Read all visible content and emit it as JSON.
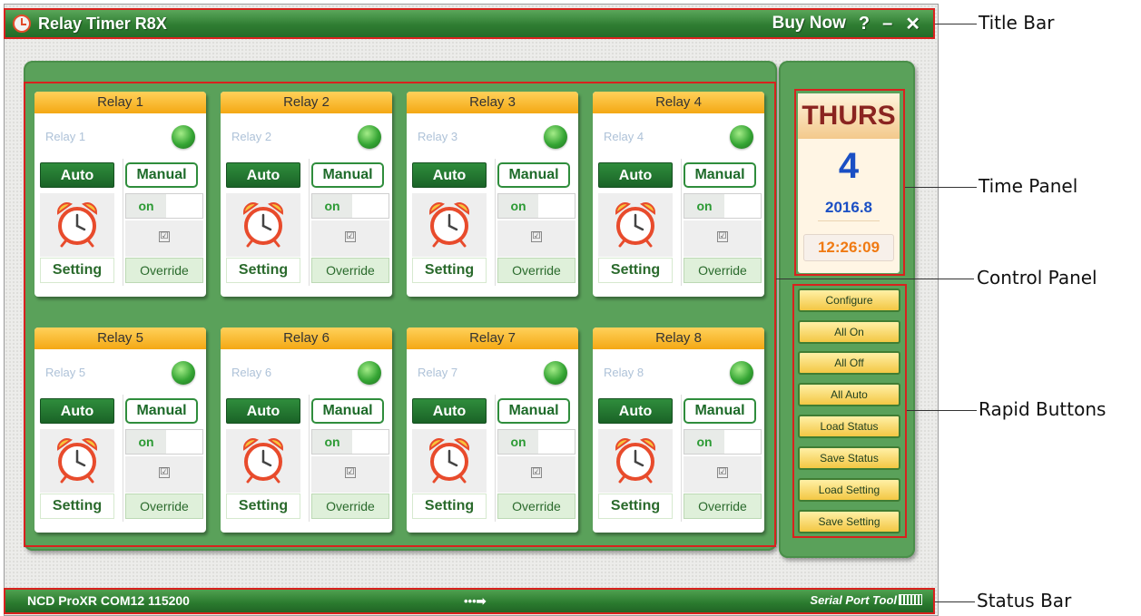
{
  "window": {
    "title": "Relay Timer R8X",
    "buy_now": "Buy Now",
    "help": "?",
    "minimize": "–",
    "close": "✕"
  },
  "relays": [
    {
      "header": "Relay 1",
      "name": "Relay 1",
      "auto": "Auto",
      "manual": "Manual",
      "toggle": "on",
      "setting": "Setting",
      "override": "Override",
      "check": "☑"
    },
    {
      "header": "Relay 2",
      "name": "Relay 2",
      "auto": "Auto",
      "manual": "Manual",
      "toggle": "on",
      "setting": "Setting",
      "override": "Override",
      "check": "☑"
    },
    {
      "header": "Relay 3",
      "name": "Relay 3",
      "auto": "Auto",
      "manual": "Manual",
      "toggle": "on",
      "setting": "Setting",
      "override": "Override",
      "check": "☑"
    },
    {
      "header": "Relay 4",
      "name": "Relay 4",
      "auto": "Auto",
      "manual": "Manual",
      "toggle": "on",
      "setting": "Setting",
      "override": "Override",
      "check": "☑"
    },
    {
      "header": "Relay 5",
      "name": "Relay 5",
      "auto": "Auto",
      "manual": "Manual",
      "toggle": "on",
      "setting": "Setting",
      "override": "Override",
      "check": "☑"
    },
    {
      "header": "Relay 6",
      "name": "Relay 6",
      "auto": "Auto",
      "manual": "Manual",
      "toggle": "on",
      "setting": "Setting",
      "override": "Override",
      "check": "☑"
    },
    {
      "header": "Relay 7",
      "name": "Relay 7",
      "auto": "Auto",
      "manual": "Manual",
      "toggle": "on",
      "setting": "Setting",
      "override": "Override",
      "check": "☑"
    },
    {
      "header": "Relay 8",
      "name": "Relay 8",
      "auto": "Auto",
      "manual": "Manual",
      "toggle": "on",
      "setting": "Setting",
      "override": "Override",
      "check": "☑"
    }
  ],
  "time": {
    "day": "THURS",
    "date": "4",
    "year_month": "2016.8",
    "clock": "12:26:09"
  },
  "rapid_buttons": [
    "Configure",
    "All On",
    "All Off",
    "All Auto",
    "Load Status",
    "Save Status",
    "Load Setting",
    "Save Setting"
  ],
  "status": {
    "connection": "NCD ProXR COM12 115200",
    "arrow": "•••➡",
    "brand": "Serial Port Tool"
  },
  "annotations": {
    "title_bar": "Title Bar",
    "time_panel": "Time Panel",
    "control_panel": "Control Panel",
    "rapid_buttons": "Rapid Buttons",
    "status_bar": "Status Bar"
  },
  "colors": {
    "theme_green": "#2f7d32",
    "relay_header": "#f4a814",
    "led_on": "#35a534",
    "highlight_box": "#d8221e",
    "clock_text": "#f07a12",
    "date_text": "#1a4fc4"
  },
  "icons": {
    "app": "alarm-clock-icon",
    "relay_setting": "alarm-clock-icon",
    "relay_status": "led-indicator-icon"
  }
}
